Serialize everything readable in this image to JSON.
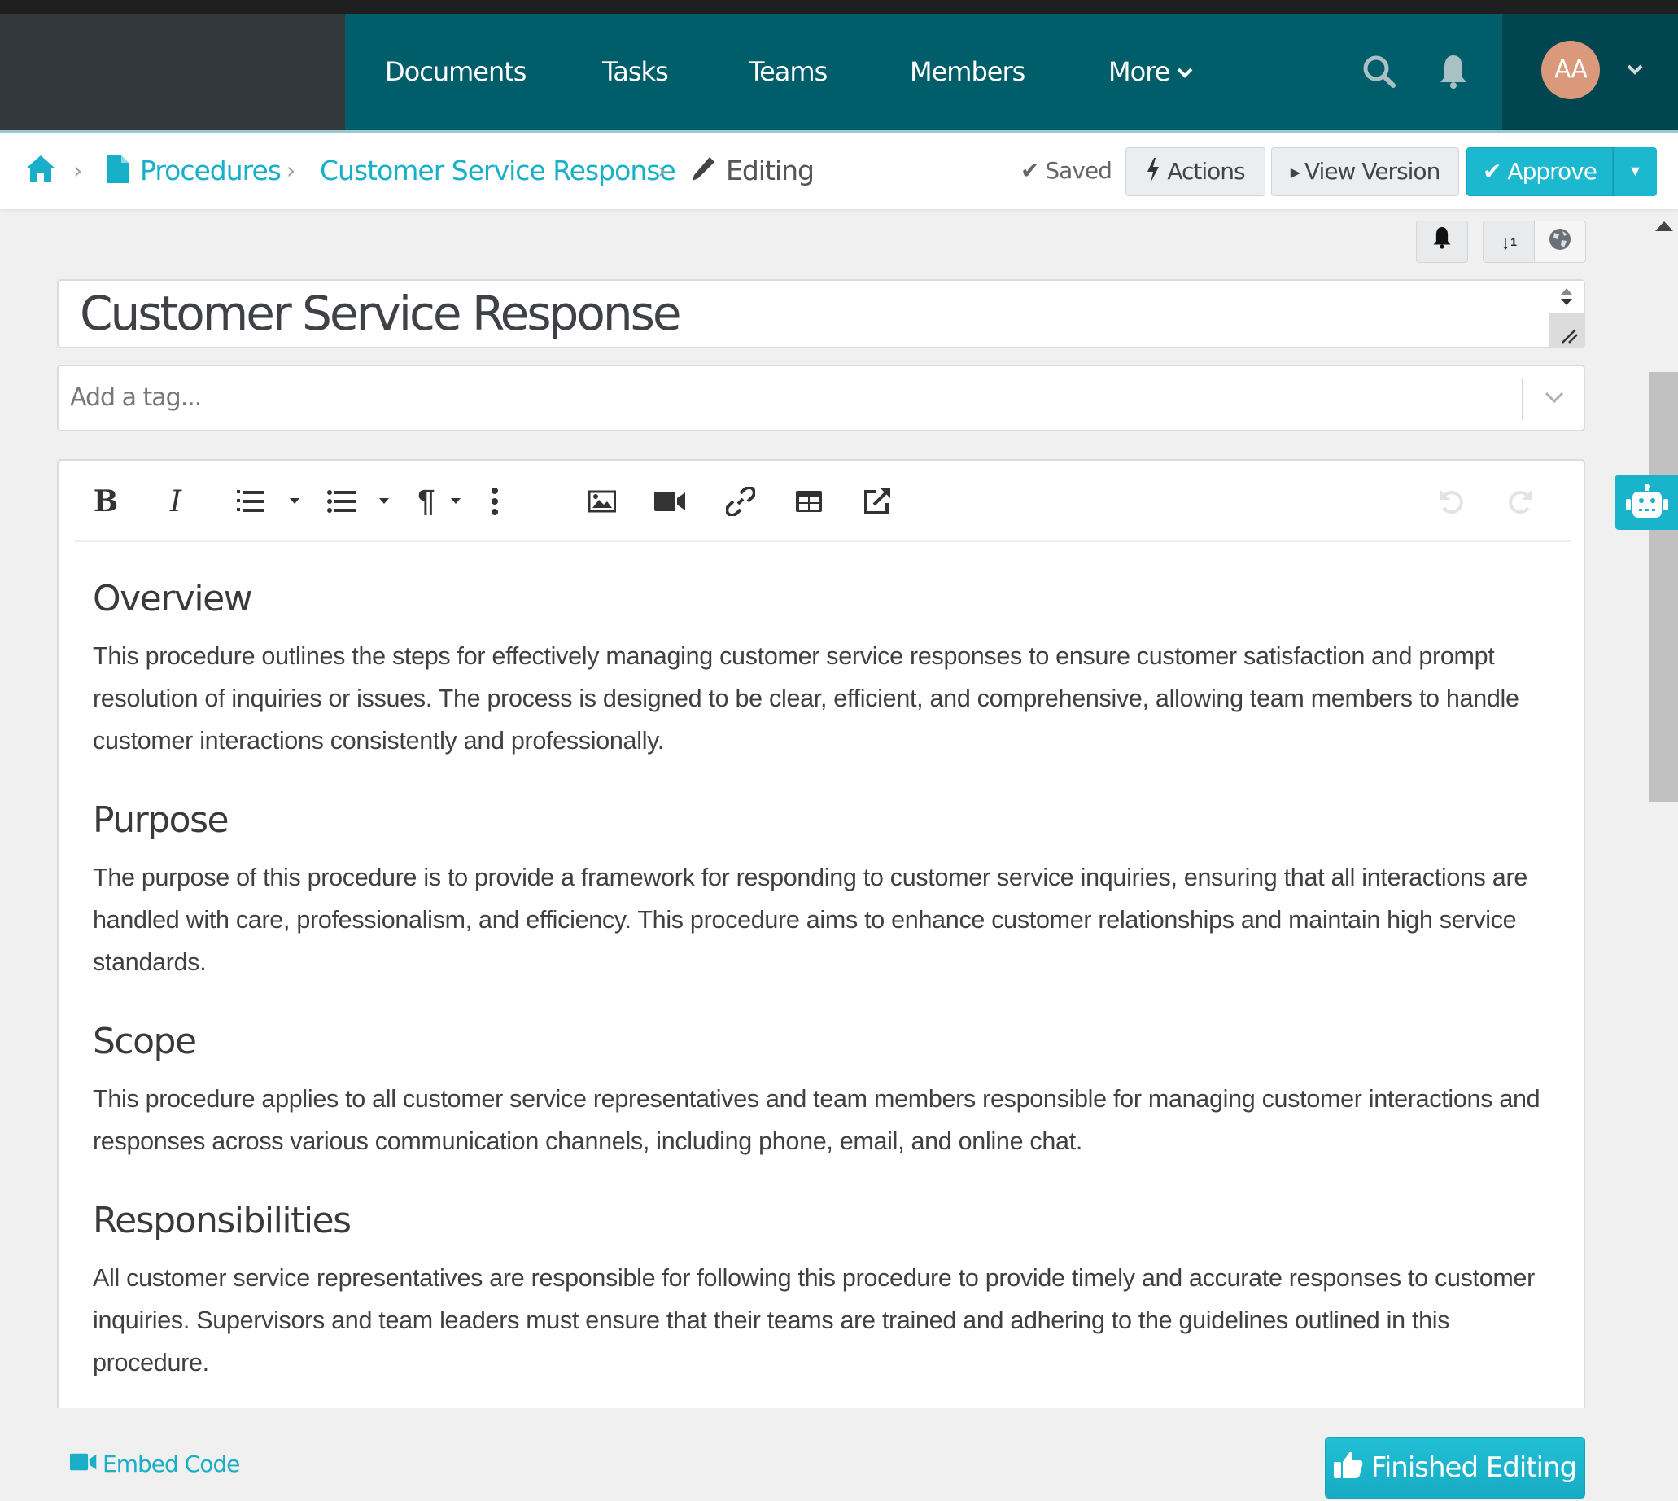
{
  "nav": {
    "items": [
      {
        "label": "Documents"
      },
      {
        "label": "Tasks"
      },
      {
        "label": "Teams"
      },
      {
        "label": "Members"
      },
      {
        "label": "More"
      }
    ],
    "avatar_initials": "AA",
    "colors": {
      "nav_bg": "#005e6a",
      "left_bg": "#33383d",
      "user_bg": "#00454f",
      "avatar_bg": "#d9997a"
    }
  },
  "breadcrumb": {
    "items": [
      {
        "label": "Procedures",
        "icon": "file-icon"
      },
      {
        "label": "Customer Service Response"
      },
      {
        "label": "Editing",
        "icon": "pencil-icon"
      }
    ]
  },
  "header_actions": {
    "saved_label": "Saved",
    "actions_label": "Actions",
    "view_version_label": "View Version",
    "approve_label": "Approve",
    "accent": "#1bb8d0"
  },
  "document": {
    "title": "Customer Service Response",
    "tag_placeholder": "Add a tag..."
  },
  "editor": {
    "toolbar": [
      "bold",
      "italic",
      "ordered-list",
      "bullet-list",
      "paragraph-format",
      "more",
      "insert-image",
      "insert-video",
      "insert-link",
      "insert-table",
      "external-link",
      "undo",
      "redo"
    ],
    "bold_glyph": "B",
    "italic_glyph": "I",
    "paragraph_glyph": "¶",
    "sections": [
      {
        "heading": "Overview",
        "body": "This procedure outlines the steps for effectively managing customer service responses to ensure customer satisfaction and prompt resolution of inquiries or issues. The process is designed to be clear, efficient, and comprehensive, allowing team members to handle customer interactions consistently and professionally."
      },
      {
        "heading": "Purpose",
        "body": "The purpose of this procedure is to provide a framework for responding to customer service inquiries, ensuring that all interactions are handled with care, professionalism, and efficiency. This procedure aims to enhance customer relationships and maintain high service standards."
      },
      {
        "heading": "Scope",
        "body": "This procedure applies to all customer service representatives and team members responsible for managing customer interactions and responses across various communication channels, including phone, email, and online chat."
      },
      {
        "heading": "Responsibilities",
        "body": "All customer service representatives are responsible for following this procedure to provide timely and accurate responses to customer inquiries. Supervisors and team leaders must ensure that their teams are trained and adhering to the guidelines outlined in this procedure."
      }
    ]
  },
  "footer": {
    "embed_label": "Embed Code",
    "finished_label": "Finished Editing"
  }
}
